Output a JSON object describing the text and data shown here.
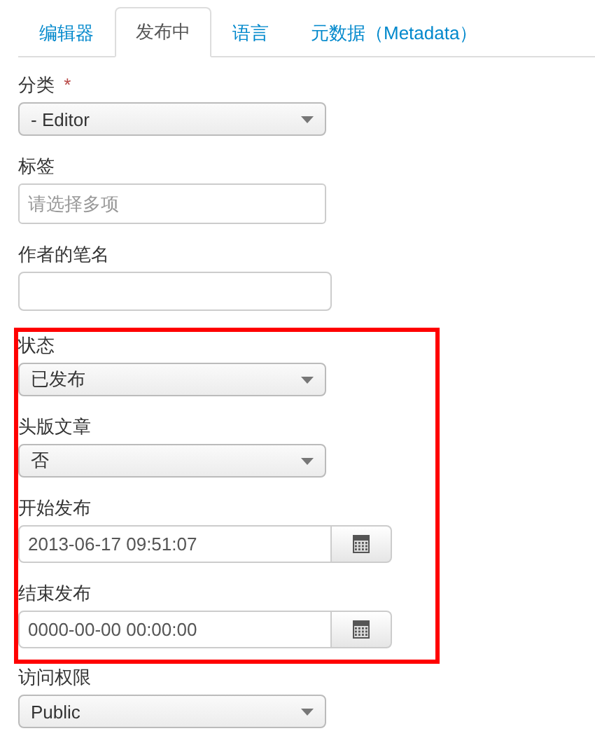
{
  "tabs": [
    {
      "label": "编辑器",
      "selected": false
    },
    {
      "label": "发布中",
      "selected": true
    },
    {
      "label": "语言",
      "selected": false
    },
    {
      "label": "元数据（Metadata）",
      "selected": false
    }
  ],
  "groups": [
    {
      "highlighted": false,
      "fields": [
        {
          "kind": "select",
          "label": "分类",
          "required_mark": "*",
          "value": "- Editor"
        },
        {
          "kind": "text",
          "label": "标签",
          "placeholder": "请选择多项"
        },
        {
          "kind": "text",
          "label": "作者的笔名"
        }
      ]
    },
    {
      "highlighted": true,
      "fields": [
        {
          "kind": "select",
          "label": "状态",
          "value": "已发布"
        },
        {
          "kind": "select",
          "label": "头版文章",
          "value": "否"
        },
        {
          "kind": "date",
          "label": "开始发布",
          "value": "2013-06-17 09:51:07"
        },
        {
          "kind": "date",
          "label": "结束发布",
          "value": "0000-00-00 00:00:00"
        }
      ]
    },
    {
      "highlighted": false,
      "fields": [
        {
          "kind": "select",
          "label": "访问权限",
          "value": "Public"
        }
      ]
    }
  ]
}
